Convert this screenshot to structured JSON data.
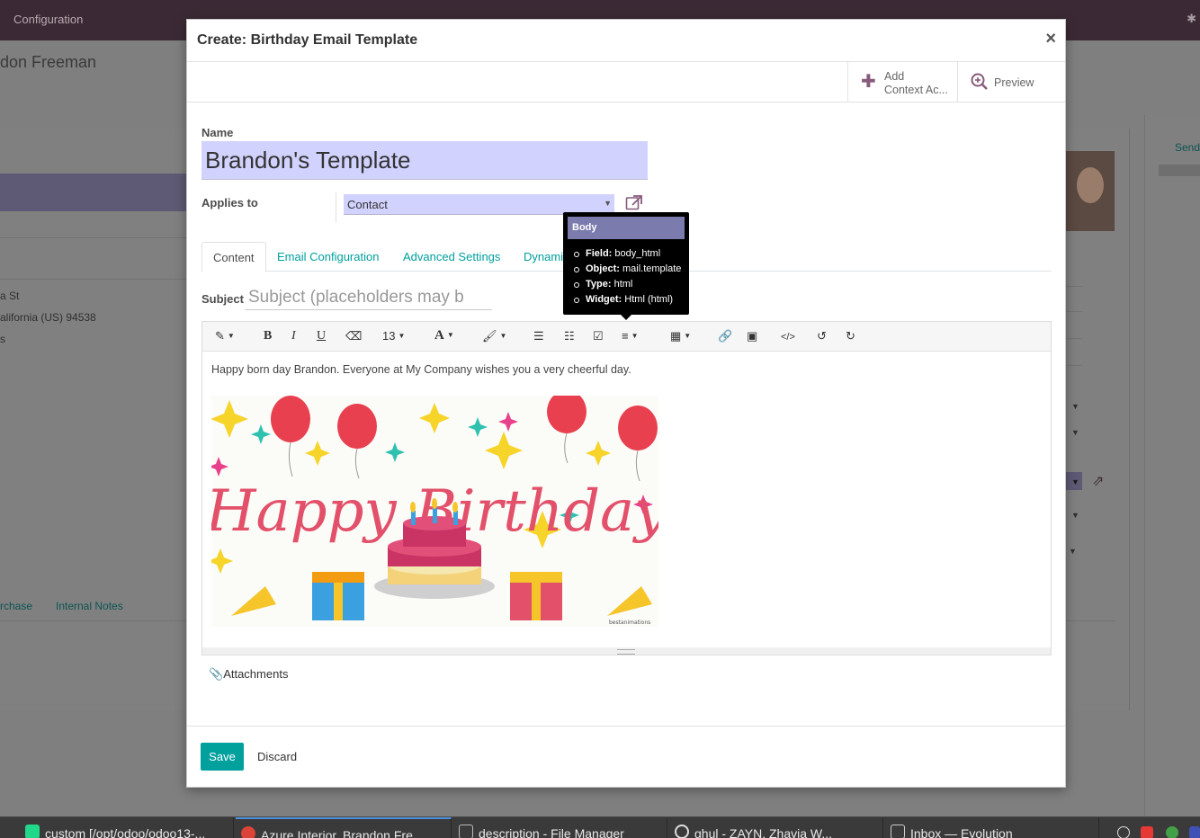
{
  "background": {
    "breadcrumb": "Configuration",
    "record_title": "don Freeman",
    "address_line1": "a St",
    "address_line2": "alifornia (US)   94538",
    "address_line3": "s",
    "tab_purchase": "rchase",
    "tab_internal_notes": "Internal Notes",
    "send_link": "Send"
  },
  "modal": {
    "title": "Create: Birthday Email Template",
    "close": "×",
    "buttons": {
      "add_context_line1": "Add",
      "add_context_line2": "Context Ac...",
      "preview": "Preview"
    },
    "name_label": "Name",
    "name_value": "Brandon's Template",
    "applies_to_label": "Applies to",
    "applies_to_value": "Contact",
    "tabs": [
      "Content",
      "Email Configuration",
      "Advanced Settings",
      "Dynami"
    ],
    "subject_label": "Subject",
    "subject_placeholder": "Subject (placeholders may b",
    "toolbar": {
      "font_size": "13"
    },
    "body_text": "Happy born day Brandon. Everyone at My Company wishes you a very cheerful day.",
    "image_text": {
      "headline": "Happy Birthday",
      "credit": "bestanimations"
    },
    "attachments": "Attachments",
    "save": "Save",
    "discard": "Discard"
  },
  "tooltip": {
    "title": "Body",
    "field_label": "Field:",
    "field_value": "body_html",
    "object_label": "Object:",
    "object_value": "mail.template",
    "type_label": "Type:",
    "type_value": "html",
    "widget_label": "Widget:",
    "widget_value": "Html (html)"
  },
  "taskbar": [
    "custom [/opt/odoo/odoo13-...",
    "Azure Interior, Brandon Fre...",
    "description - File Manager",
    "ghul - ZAYN, Zhavia W...",
    "Inbox — Evolution"
  ],
  "colors": {
    "primary": "#00a09d",
    "brand": "#875a7b",
    "input_bg": "#d2d2ff",
    "tooltip_header": "#7c7bad"
  }
}
